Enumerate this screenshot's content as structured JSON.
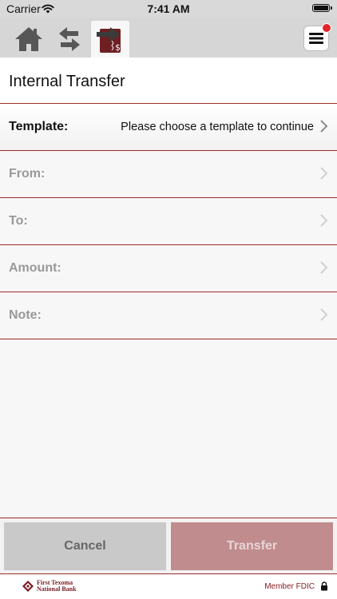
{
  "status_bar": {
    "carrier": "Carrier",
    "time": "7:41 AM"
  },
  "nav": {
    "tabs": [
      {
        "icon": "home-icon"
      },
      {
        "icon": "transfer-arrows-icon"
      },
      {
        "icon": "transfer-money-icon",
        "active": true
      }
    ],
    "menu_icon": "hamburger-menu-icon",
    "notification": true
  },
  "page": {
    "title": "Internal Transfer"
  },
  "form": {
    "template": {
      "label": "Template:",
      "value": "Please choose a template to continue"
    },
    "from": {
      "label": "From:",
      "value": ""
    },
    "to": {
      "label": "To:",
      "value": ""
    },
    "amount": {
      "label": "Amount:",
      "value": ""
    },
    "note": {
      "label": "Note:",
      "value": ""
    }
  },
  "actions": {
    "cancel_label": "Cancel",
    "transfer_label": "Transfer"
  },
  "footer": {
    "bank_line1": "First Texoma",
    "bank_line2": "National Bank",
    "fdic": "Member FDIC"
  },
  "colors": {
    "accent": "#9e2a2b",
    "transfer_disabled": "#c08c8e",
    "notification_dot": "#e3262b"
  }
}
